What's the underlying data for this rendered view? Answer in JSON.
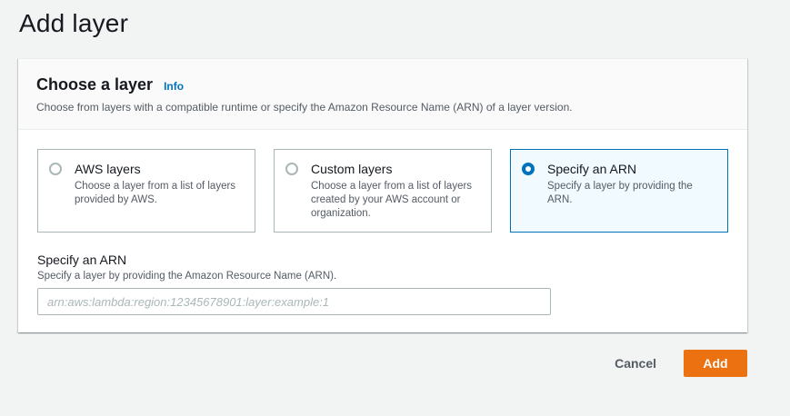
{
  "page": {
    "title": "Add layer"
  },
  "panel": {
    "title": "Choose a layer",
    "info_link": "Info",
    "description": "Choose from layers with a compatible runtime or specify the Amazon Resource Name (ARN) of a layer version."
  },
  "layer_source": {
    "options": [
      {
        "label": "AWS layers",
        "description": "Choose a layer from a list of layers provided by AWS.",
        "selected": false
      },
      {
        "label": "Custom layers",
        "description": "Choose a layer from a list of layers created by your AWS account or organization.",
        "selected": false
      },
      {
        "label": "Specify an ARN",
        "description": "Specify a layer by providing the ARN.",
        "selected": true
      }
    ]
  },
  "arn_field": {
    "label": "Specify an ARN",
    "description": "Specify a layer by providing the Amazon Resource Name (ARN).",
    "value": "",
    "placeholder": "arn:aws:lambda:region:12345678901:layer:example:1"
  },
  "actions": {
    "cancel_label": "Cancel",
    "add_label": "Add"
  },
  "colors": {
    "accent": "#0073bb",
    "primary_button": "#ec7211",
    "selected_tile_bg": "#f1faff"
  }
}
